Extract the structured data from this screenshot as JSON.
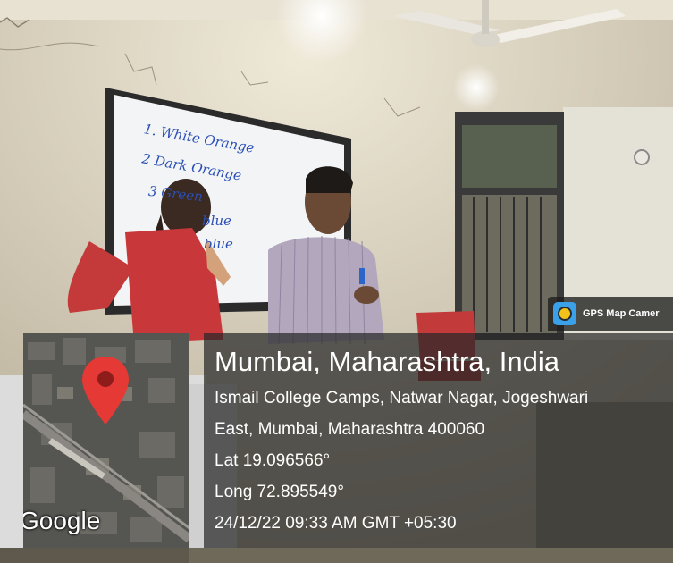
{
  "whiteboard": {
    "lines": [
      "1. White Orange",
      "2 Dark Orange",
      "3 Green",
      "blue",
      "blue"
    ]
  },
  "badge": {
    "label": "GPS Map Camer",
    "icon": "gps-map-camera-icon"
  },
  "map": {
    "attribution": "Google",
    "icon": "map-pin-icon",
    "pin_color": "#e53935"
  },
  "location": {
    "title": "Mumbai, Maharashtra, India",
    "address_line1": "Ismail College Camps, Natwar Nagar, Jogeshwari",
    "address_line2": "East, Mumbai, Maharashtra 400060",
    "lat": "Lat 19.096566°",
    "long": "Long 72.895549°",
    "datetime": "24/12/22 09:33 AM GMT +05:30"
  }
}
